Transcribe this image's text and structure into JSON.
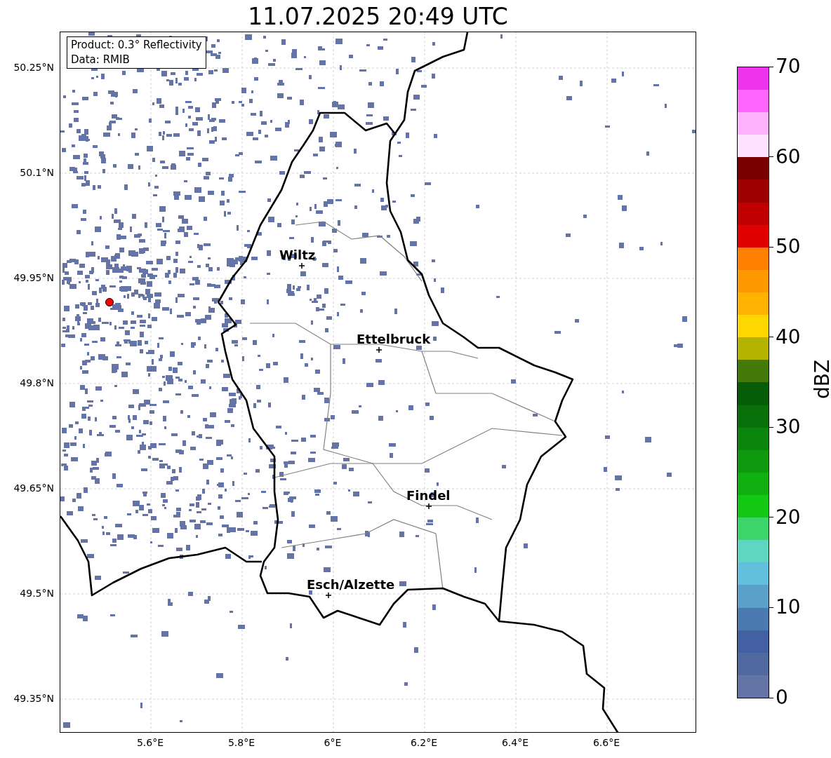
{
  "title": "11.07.2025 20:49 UTC",
  "info_box": {
    "lines": [
      "Product: 0.3° Reflectivity",
      "Data: RMIB"
    ]
  },
  "map": {
    "places": [
      {
        "name": "Wiltz"
      },
      {
        "name": "Ettelbruck"
      },
      {
        "name": "Findel"
      },
      {
        "name": "Esch/Alzette"
      }
    ]
  },
  "y_ticks": [
    "50.25°N",
    "50.1°N",
    "49.95°N",
    "49.8°N",
    "49.65°N",
    "49.5°N",
    "49.35°N"
  ],
  "x_ticks": [
    "5.6°E",
    "5.8°E",
    "6°E",
    "6.2°E",
    "6.4°E",
    "6.6°E"
  ],
  "colorbar": {
    "label": "dBZ",
    "ticks": [
      "70",
      "60",
      "50",
      "40",
      "30",
      "20",
      "10",
      "0"
    ],
    "bands": [
      {
        "color": "#6474a6"
      },
      {
        "color": "#50699e"
      },
      {
        "color": "#4260a2"
      },
      {
        "color": "#4a7ab0"
      },
      {
        "color": "#5aa0c8"
      },
      {
        "color": "#62c0dc"
      },
      {
        "color": "#5fd6c0"
      },
      {
        "color": "#3dd66b"
      },
      {
        "color": "#12c812"
      },
      {
        "color": "#10b010"
      },
      {
        "color": "#0e990e"
      },
      {
        "color": "#0c850c"
      },
      {
        "color": "#0a700a"
      },
      {
        "color": "#075c07"
      },
      {
        "color": "#447a0a"
      },
      {
        "color": "#b3b300"
      },
      {
        "color": "#ffd700"
      },
      {
        "color": "#ffb300"
      },
      {
        "color": "#ff9900"
      },
      {
        "color": "#ff7f00"
      },
      {
        "color": "#e00000"
      },
      {
        "color": "#c00000"
      },
      {
        "color": "#9c0000"
      },
      {
        "color": "#7a0000"
      },
      {
        "color": "#ffe0ff"
      },
      {
        "color": "#ffb3ff"
      },
      {
        "color": "#ff66ff"
      },
      {
        "color": "#ee33ee"
      }
    ]
  }
}
